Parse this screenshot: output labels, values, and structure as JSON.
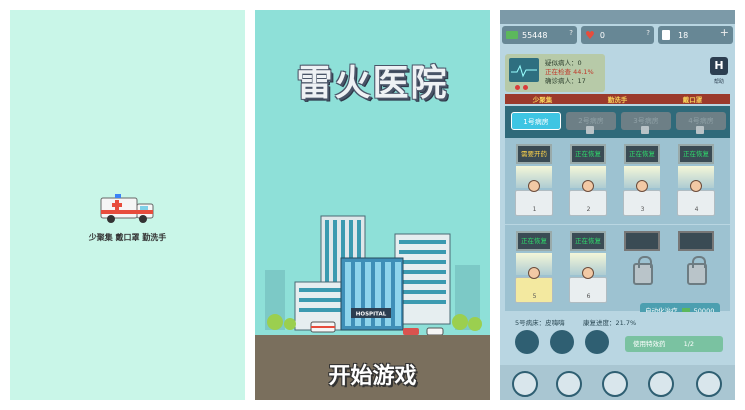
{
  "splash": {
    "subtitle": "少聚集 戴口罩 勤洗手"
  },
  "title_screen": {
    "title": "雷火医院",
    "start_button": "开始游戏",
    "hospital_sign": "HOSPITAL"
  },
  "game": {
    "resources": {
      "money": "55448",
      "hearts": "0",
      "beds": "18",
      "help": "?"
    },
    "monitor": {
      "suspected_label": "疑似病人：",
      "suspected_value": "0",
      "checking_label": "正在检查",
      "checking_value": "44.1%",
      "confirmed_label": "确诊病人：",
      "confirmed_value": "17"
    },
    "help_button": "H",
    "help_label": "帮助",
    "slogans": [
      "少聚集",
      "勤洗手",
      "戴口罩"
    ],
    "ward_tabs": [
      "1号病房",
      "2号病房",
      "3号病房",
      "4号病房"
    ],
    "beds_row1": [
      {
        "status": "需要开药",
        "number": "1"
      },
      {
        "status": "正在恢复",
        "number": "2"
      },
      {
        "status": "正在恢复",
        "number": "3"
      },
      {
        "status": "正在恢复",
        "number": "4"
      }
    ],
    "beds_row2": [
      {
        "status": "正在恢复",
        "number": "5"
      },
      {
        "status": "正在恢复",
        "number": "6"
      },
      {
        "status": "",
        "number": ""
      },
      {
        "status": "",
        "number": ""
      }
    ],
    "selected_bed": "5号病床：皮嗨嗨",
    "recovery": "康复进度：21.7%",
    "auto_treat": "自动化治疗",
    "auto_cost": "50000",
    "use_medicine": "使用特效药",
    "medicine_count": "1/2"
  },
  "colors": {
    "splash_bg": "#c9f6e8",
    "title_bg": "#8ee0d8",
    "game_bg": "#b9d6e2",
    "accent": "#3ec5e3"
  }
}
